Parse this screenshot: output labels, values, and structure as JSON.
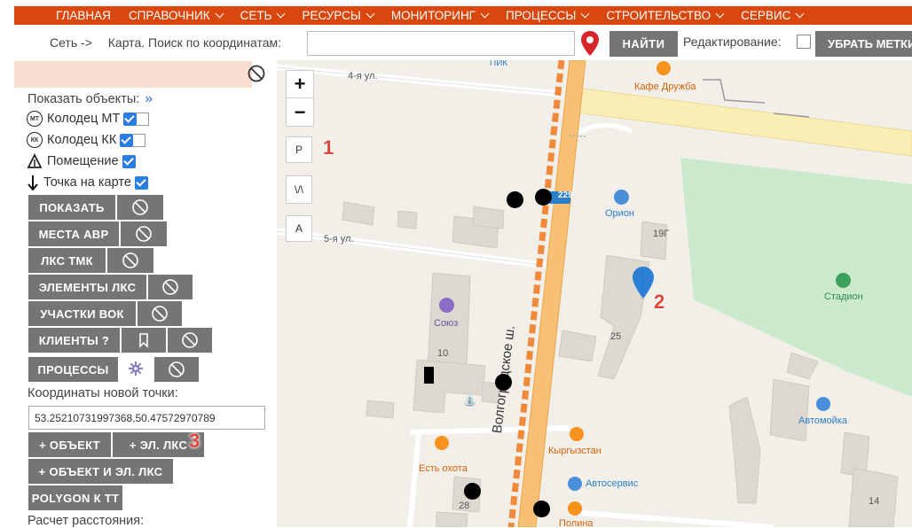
{
  "nav": {
    "items": [
      {
        "label": "ГЛАВНАЯ",
        "dropdown": false
      },
      {
        "label": "СПРАВОЧНИК",
        "dropdown": true
      },
      {
        "label": "СЕТЬ",
        "dropdown": true
      },
      {
        "label": "РЕСУРСЫ",
        "dropdown": true
      },
      {
        "label": "МОНИТОРИНГ",
        "dropdown": true
      },
      {
        "label": "ПРОЦЕССЫ",
        "dropdown": true
      },
      {
        "label": "СТРОИТЕЛЬСТВО",
        "dropdown": true
      },
      {
        "label": "СЕРВИС",
        "dropdown": true
      }
    ],
    "accent": "#d9470f"
  },
  "search": {
    "breadcrumb_root": "Сеть ->",
    "breadcrumb_page": "Карта. Поиск по координатам:",
    "value": "",
    "find_label": "НАЙТИ",
    "edit_label": "Редактирование:",
    "edit_checked": false,
    "remove_label": "УБРАТЬ МЕТКИ"
  },
  "panel": {
    "show_label": "Показать объекты:",
    "show_arrow": "»",
    "filters": [
      {
        "icon": "МТ",
        "label": "Колодец МТ",
        "checked": true
      },
      {
        "icon": "КК",
        "label": "Колодец КК",
        "checked": true
      },
      {
        "icon": "triangle",
        "label": "Помещение",
        "checked": true
      },
      {
        "icon": "arrow-down",
        "label": "Точка на карте",
        "checked": true
      }
    ],
    "buttons": {
      "show": "ПОКАЗАТЬ",
      "avr": "МЕСТА АВР",
      "lks_tmk": "ЛКС ТМК",
      "lks_elements": "ЭЛЕМЕНТЫ ЛКС",
      "vok": "УЧАСТКИ ВОК",
      "clients": "КЛИЕНТЫ ?",
      "processes": "ПРОЦЕССЫ",
      "add_object": "+ ОБЪЕКТ",
      "add_lks": "+ ЭЛ. ЛКС",
      "add_both": "+ ОБЪЕКТ И ЭЛ. ЛКС",
      "polygon": "POLYGON К ТТ"
    },
    "coord_label": "Координаты новой точки:",
    "coord_value": "53.25210731997368,50.47572970789",
    "distance_label": "Расчет расстояния:"
  },
  "map": {
    "controls": {
      "zoom_in": "+",
      "zoom_out": "−",
      "ctl_p": "P",
      "ctl_w": "\\/\\",
      "ctl_a": "A"
    },
    "streets": {
      "s4": "4-я ул.",
      "s5": "5-я ул.",
      "main": "Волгоградское ш."
    },
    "route_badge": "229",
    "pois": {
      "cafe": "Кафе Дружба",
      "orion": "Орион",
      "stadium": "Стадион",
      "soyuz": "Союз",
      "kyrgyzstan": "Кыргызстан",
      "autoservice": "Автосервис",
      "automoyka": "Автомойка",
      "ohota": "Есть охота",
      "pik": "ПИК",
      "polina": "Полина"
    },
    "houses": {
      "h19g": "19Г",
      "h25": "25",
      "h10": "10",
      "h28": "28",
      "h14": "14"
    },
    "annotations": {
      "a1": "1",
      "a2": "2",
      "a3": "3"
    }
  }
}
